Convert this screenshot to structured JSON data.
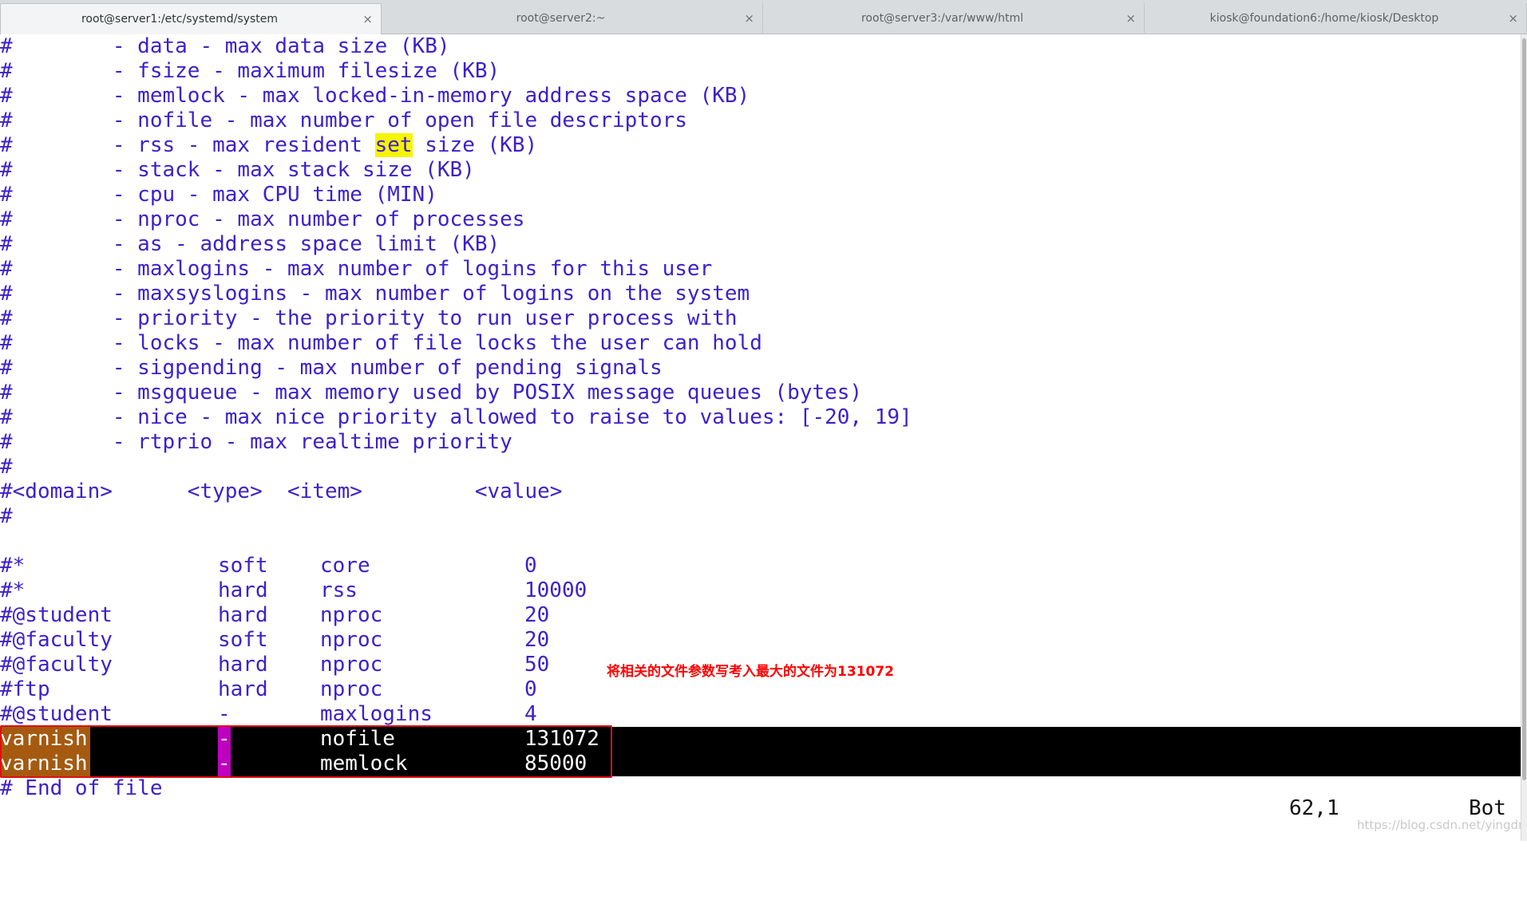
{
  "tabs": [
    {
      "title": "root@server1:/etc/systemd/system",
      "close": "×"
    },
    {
      "title": "root@server2:~",
      "close": "×"
    },
    {
      "title": "root@server3:/var/www/html",
      "close": "×"
    },
    {
      "title": "kiosk@foundation6:/home/kiosk/Desktop",
      "close": "×"
    }
  ],
  "comments": {
    "data": "#        - data - max data size (KB)",
    "fsize": "#        - fsize - maximum filesize (KB)",
    "memlock": "#        - memlock - max locked-in-memory address space (KB)",
    "nofile": "#        - nofile - max number of open file descriptors",
    "rss_pre": "#        - rss - max resident ",
    "rss_hl": "set",
    "rss_post": " size (KB)",
    "stack": "#        - stack - max stack size (KB)",
    "cpu": "#        - cpu - max CPU time (MIN)",
    "nproc": "#        - nproc - max number of processes",
    "as": "#        - as - address space limit (KB)",
    "maxlogins": "#        - maxlogins - max number of logins for this user",
    "maxsyslogins": "#        - maxsyslogins - max number of logins on the system",
    "priority": "#        - priority - the priority to run user process with",
    "locks": "#        - locks - max number of file locks the user can hold",
    "sigpending": "#        - sigpending - max number of pending signals",
    "msgqueue": "#        - msgqueue - max memory used by POSIX message queues (bytes)",
    "nice": "#        - nice - max nice priority allowed to raise to values: [-20, 19]",
    "rtprio": "#        - rtprio - max realtime priority",
    "hash1": "#",
    "header": "#<domain>      <type>  <item>         <value>",
    "hash2": "#"
  },
  "limits_rows": [
    {
      "domain": "#*",
      "type": "soft",
      "item": "core",
      "value": "0"
    },
    {
      "domain": "#*",
      "type": "hard",
      "item": "rss",
      "value": "10000"
    },
    {
      "domain": "#@student",
      "type": "hard",
      "item": "nproc",
      "value": "20"
    },
    {
      "domain": "#@faculty",
      "type": "soft",
      "item": "nproc",
      "value": "20"
    },
    {
      "domain": "#@faculty",
      "type": "hard",
      "item": "nproc",
      "value": "50"
    },
    {
      "domain": "#ftp",
      "type": "hard",
      "item": "nproc",
      "value": "0"
    },
    {
      "domain": "#@student",
      "type": "-",
      "item": "maxlogins",
      "value": "4"
    }
  ],
  "varnish_rows": [
    {
      "domain": "varnish",
      "type": "-",
      "item": "nofile",
      "value": "131072"
    },
    {
      "domain": "varnish",
      "type": "-",
      "item": "memlock",
      "value": "85000"
    }
  ],
  "end_line": "# End of file",
  "annotation": "将相关的文件参数写考入最大的文件为131072",
  "status": {
    "position": "62,1",
    "scroll": "Bot"
  },
  "watermark": "https://blog.csdn.net/yingdry",
  "colors": {
    "text": "#3d1fcc",
    "selection_bg": "#000000",
    "orange": "#a55a10",
    "magenta": "#c000c0",
    "annotation": "#ff0000",
    "highlight": "#f5f500"
  }
}
